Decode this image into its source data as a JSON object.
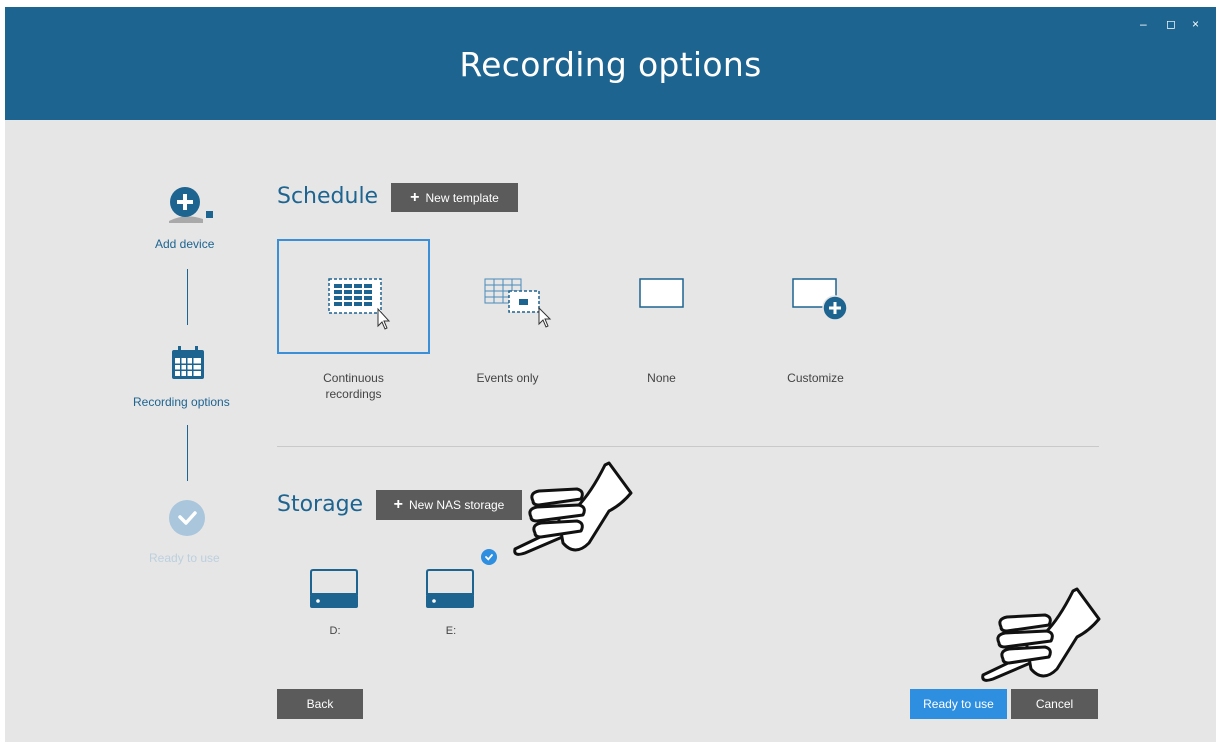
{
  "window": {
    "title": "Recording options",
    "controls": {
      "minimize": "–",
      "maximize": "◻",
      "close": "×"
    }
  },
  "sidebar": {
    "steps": [
      {
        "label": "Add device",
        "state": "done"
      },
      {
        "label": "Recording options",
        "state": "current"
      },
      {
        "label": "Ready to use",
        "state": "pending"
      }
    ]
  },
  "schedule": {
    "title": "Schedule",
    "new_template_label": "New template",
    "options": [
      {
        "label": "Continuous recordings",
        "selected": true
      },
      {
        "label": "Events only",
        "selected": false
      },
      {
        "label": "None",
        "selected": false
      },
      {
        "label": "Customize",
        "selected": false
      }
    ]
  },
  "storage": {
    "title": "Storage",
    "new_nas_label": "New NAS storage",
    "drives": [
      {
        "label": "D:",
        "selected": false
      },
      {
        "label": "E:",
        "selected": true
      }
    ]
  },
  "footer": {
    "back_label": "Back",
    "ready_label": "Ready to use",
    "cancel_label": "Cancel"
  },
  "colors": {
    "accent": "#1d6490",
    "primary_button": "#2e8ee0",
    "dark_button": "#5b5b5b",
    "background": "#e6e6e6",
    "pending_step": "#a9c6dc"
  }
}
